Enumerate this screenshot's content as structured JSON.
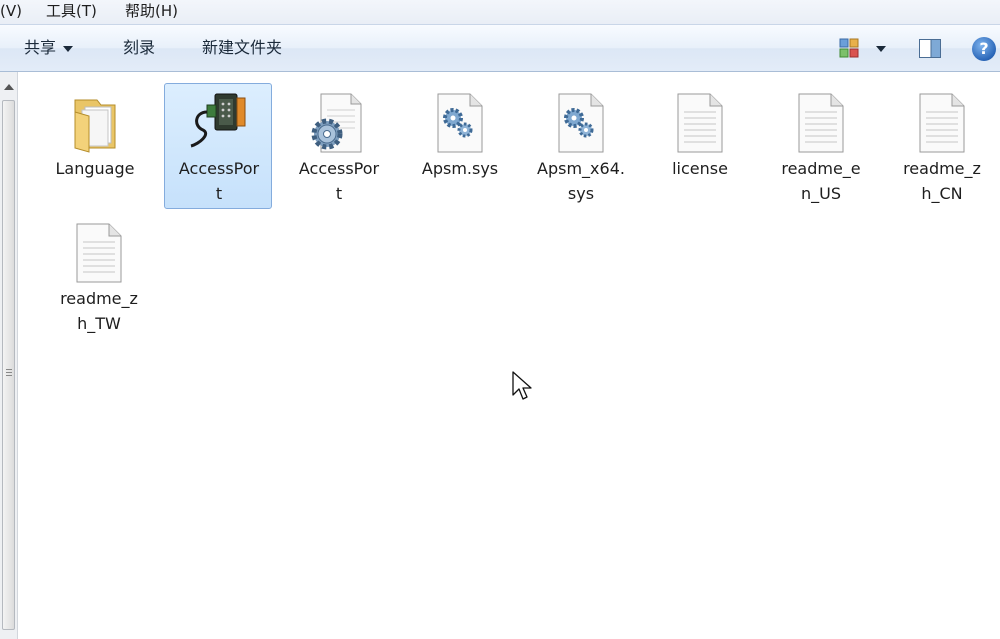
{
  "menubar": {
    "items": [
      "(V)",
      "工具(T)",
      "帮助(H)"
    ]
  },
  "toolbar": {
    "share_label": "共享",
    "burn_label": "刻录",
    "new_folder_label": "新建文件夹",
    "views_icon": "views-icon",
    "preview_pane_icon": "preview-pane-icon",
    "help_label": "?"
  },
  "files": [
    {
      "name": "Language",
      "line1": "Language",
      "line2": "",
      "icon": "folder-icon"
    },
    {
      "name": "AccessPort",
      "line1": "AccessPor",
      "line2": "t",
      "icon": "serial-port-app-icon",
      "selected": true
    },
    {
      "name": "AccessPort",
      "line1": "AccessPor",
      "line2": "t",
      "icon": "config-file-icon"
    },
    {
      "name": "Apsm.sys",
      "line1": "Apsm.sys",
      "line2": "",
      "icon": "system-file-icon"
    },
    {
      "name": "Apsm_x64.sys",
      "line1": "Apsm_x64.",
      "line2": "sys",
      "icon": "system-file-icon"
    },
    {
      "name": "license",
      "line1": "license",
      "line2": "",
      "icon": "text-file-icon"
    },
    {
      "name": "readme_en_US",
      "line1": "readme_e",
      "line2": "n_US",
      "icon": "text-file-icon"
    },
    {
      "name": "readme_zh_CN",
      "line1": "readme_z",
      "line2": "h_CN",
      "icon": "text-file-icon"
    },
    {
      "name": "readme_zh_TW",
      "line1": "readme_z",
      "line2": "h_TW",
      "icon": "text-file-icon"
    }
  ],
  "colors": {
    "selection_bg": "#c6e1fb",
    "selection_border": "#84acdd",
    "toolbar_bg": "#e3ecf8"
  }
}
